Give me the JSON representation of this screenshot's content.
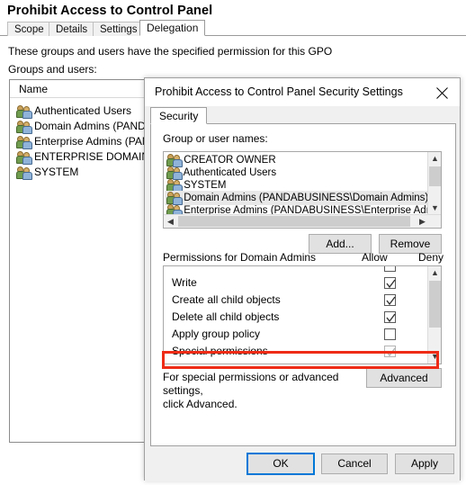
{
  "background_window": {
    "title": "Prohibit Access to Control Panel",
    "tabs": [
      {
        "label": "Scope",
        "active": false
      },
      {
        "label": "Details",
        "active": false
      },
      {
        "label": "Settings",
        "active": false
      },
      {
        "label": "Delegation",
        "active": true
      }
    ],
    "description": "These groups and users have the specified permission for this GPO",
    "list_label": "Groups and users:",
    "list_column_header": "Name",
    "list_items": [
      {
        "icon": "group-icon",
        "label": "Authenticated Users"
      },
      {
        "icon": "group-icon",
        "label": "Domain Admins (PANDAI"
      },
      {
        "icon": "group-icon",
        "label": "Enterprise Admins (PAND"
      },
      {
        "icon": "group-icon",
        "label": "ENTERPRISE DOMAIN "
      },
      {
        "icon": "group-icon",
        "label": "SYSTEM"
      }
    ]
  },
  "dialog": {
    "title": "Prohibit Access to Control Panel Security Settings",
    "close_icon": "close-icon",
    "tab": {
      "label": "Security",
      "active": true
    },
    "group_names_label": "Group or user names:",
    "group_names": [
      {
        "icon": "group-icon",
        "label": "CREATOR OWNER",
        "selected": false
      },
      {
        "icon": "group-icon",
        "label": "Authenticated Users",
        "selected": false
      },
      {
        "icon": "group-icon",
        "label": "SYSTEM",
        "selected": false
      },
      {
        "icon": "group-icon",
        "label": "Domain Admins (PANDABUSINESS\\Domain Admins)",
        "selected": true
      },
      {
        "icon": "group-icon",
        "label": "Enterprise Admins (PANDABUSINESS\\Enterprise Admins)",
        "selected": false
      }
    ],
    "add_button": "Add...",
    "remove_button": "Remove",
    "permissions_label": "Permissions for Domain Admins",
    "allow_column": "Allow",
    "deny_column": "Deny",
    "permissions": [
      {
        "name": "Write",
        "allow": "checked",
        "deny": "unchecked"
      },
      {
        "name": "Create all child objects",
        "allow": "checked",
        "deny": "unchecked"
      },
      {
        "name": "Delete all child objects",
        "allow": "checked",
        "deny": "unchecked"
      },
      {
        "name": "Apply group policy",
        "allow": "unchecked",
        "deny": "checked",
        "highlighted": true
      },
      {
        "name": "Special permissions",
        "allow": "checked-disabled",
        "deny": "unchecked-disabled"
      }
    ],
    "advanced_hint_line1": "For special permissions or advanced settings,",
    "advanced_hint_line2": "click Advanced.",
    "advanced_button": "Advanced",
    "ok_button": "OK",
    "cancel_button": "Cancel",
    "apply_button": "Apply"
  },
  "annotation": {
    "highlight_color": "#ee2b16",
    "focus_color": "#0078d7"
  }
}
